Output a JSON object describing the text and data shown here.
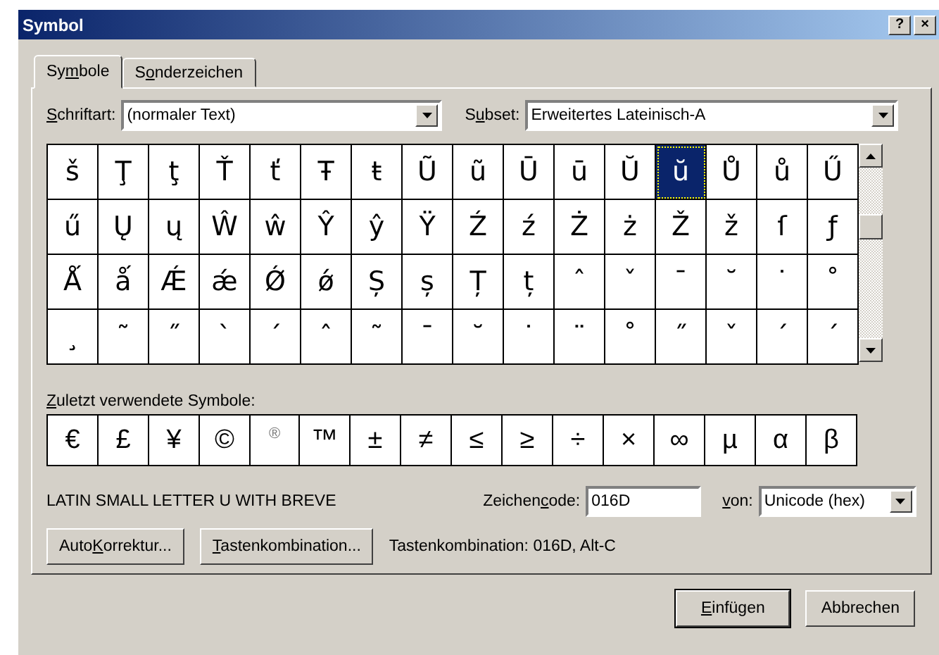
{
  "window": {
    "title": "Symbol",
    "title_buttons": [
      "?",
      "×"
    ]
  },
  "tabs": [
    {
      "label": {
        "before": "Sy",
        "key": "m",
        "after": "bole"
      },
      "selected": true
    },
    {
      "label": {
        "before": "S",
        "key": "o",
        "after": "nderzeichen"
      },
      "selected": false
    }
  ],
  "font_field": {
    "label": {
      "key": "S",
      "after": "chriftart:"
    },
    "value": "(normaler Text)"
  },
  "subset_field": {
    "label": {
      "before": "S",
      "key": "u",
      "after": "bset:"
    },
    "value": "Erweitertes Lateinisch-A"
  },
  "symbol_grid": {
    "rows": [
      [
        {
          "char": "š",
          "selected": false
        },
        {
          "char": "Ţ",
          "selected": false
        },
        {
          "char": "ţ",
          "selected": false
        },
        {
          "char": "Ť",
          "selected": false
        },
        {
          "char": "ť",
          "selected": false
        },
        {
          "char": "Ŧ",
          "selected": false
        },
        {
          "char": "ŧ",
          "selected": false
        },
        {
          "char": "Ũ",
          "selected": false
        },
        {
          "char": "ũ",
          "selected": false
        },
        {
          "char": "Ū",
          "selected": false
        },
        {
          "char": "ū",
          "selected": false
        },
        {
          "char": "Ŭ",
          "selected": false
        },
        {
          "char": "ŭ",
          "selected": true
        },
        {
          "char": "Ů",
          "selected": false
        },
        {
          "char": "ů",
          "selected": false
        },
        {
          "char": "Ű",
          "selected": false
        }
      ],
      [
        {
          "char": "ű",
          "selected": false
        },
        {
          "char": "Ų",
          "selected": false
        },
        {
          "char": "ų",
          "selected": false
        },
        {
          "char": "Ŵ",
          "selected": false
        },
        {
          "char": "ŵ",
          "selected": false
        },
        {
          "char": "Ŷ",
          "selected": false
        },
        {
          "char": "ŷ",
          "selected": false
        },
        {
          "char": "Ÿ",
          "selected": false
        },
        {
          "char": "Ź",
          "selected": false
        },
        {
          "char": "ź",
          "selected": false
        },
        {
          "char": "Ż",
          "selected": false
        },
        {
          "char": "ż",
          "selected": false
        },
        {
          "char": "Ž",
          "selected": false
        },
        {
          "char": "ž",
          "selected": false
        },
        {
          "char": "ſ",
          "selected": false
        },
        {
          "char": "ƒ",
          "selected": false
        }
      ],
      [
        {
          "char": "Ǻ",
          "selected": false
        },
        {
          "char": "ǻ",
          "selected": false
        },
        {
          "char": "Ǽ",
          "selected": false
        },
        {
          "char": "ǽ",
          "selected": false
        },
        {
          "char": "Ǿ",
          "selected": false
        },
        {
          "char": "ǿ",
          "selected": false
        },
        {
          "char": "Ș",
          "selected": false
        },
        {
          "char": "ș",
          "selected": false
        },
        {
          "char": "Ț",
          "selected": false
        },
        {
          "char": "ț",
          "selected": false
        },
        {
          "char": "ˆ",
          "selected": false
        },
        {
          "char": "ˇ",
          "selected": false
        },
        {
          "char": "ˉ",
          "selected": false
        },
        {
          "char": "˘",
          "selected": false
        },
        {
          "char": "˙",
          "selected": false
        },
        {
          "char": "˚",
          "selected": false
        }
      ],
      [
        {
          "char": "¸",
          "selected": false
        },
        {
          "char": "˜",
          "selected": false
        },
        {
          "char": "˝",
          "selected": false
        },
        {
          "char": "`",
          "selected": false
        },
        {
          "char": "´",
          "selected": false
        },
        {
          "char": "ˆ",
          "selected": false
        },
        {
          "char": "˜",
          "selected": false
        },
        {
          "char": "¯",
          "selected": false
        },
        {
          "char": "˘",
          "selected": false
        },
        {
          "char": "˙",
          "selected": false
        },
        {
          "char": "¨",
          "selected": false
        },
        {
          "char": "˚",
          "selected": false
        },
        {
          "char": "˝",
          "selected": false
        },
        {
          "char": "ˇ",
          "selected": false
        },
        {
          "char": "΄",
          "selected": false
        },
        {
          "char": "΄",
          "selected": false
        }
      ]
    ]
  },
  "recent": {
    "label": {
      "key": "Z",
      "after": "uletzt verwendete Symbole:"
    },
    "symbols": [
      "€",
      "£",
      "¥",
      "©",
      "®",
      "™",
      "±",
      "≠",
      "≤",
      "≥",
      "÷",
      "×",
      "∞",
      "µ",
      "α",
      "β"
    ]
  },
  "character_name": "LATIN SMALL LETTER U WITH BREVE",
  "code_field": {
    "label": {
      "before": "Zeichen",
      "key": "c",
      "after": "ode:"
    },
    "value": "016D"
  },
  "from_field": {
    "label": {
      "key": "v",
      "after": "on:"
    },
    "value": "Unicode (hex)"
  },
  "buttons": [
    {
      "label": {
        "before": "Auto",
        "key": "K",
        "after": "orrektur..."
      }
    },
    {
      "label": {
        "key": "T",
        "after": "astenkombination..."
      }
    }
  ],
  "shortcut_text": "Tastenkombination: 016D, Alt-C",
  "footer_buttons": [
    {
      "label": {
        "key": "E",
        "after": "infügen"
      },
      "default": true
    },
    {
      "label": "Abbrechen",
      "default": false
    }
  ]
}
